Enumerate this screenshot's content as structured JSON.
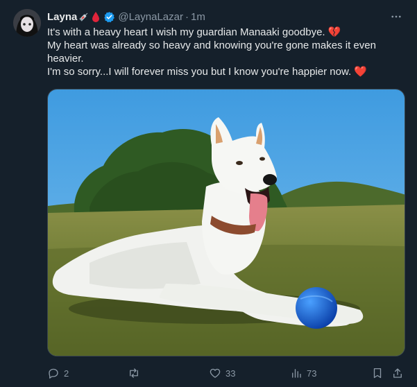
{
  "author": {
    "name": "Layna",
    "handle": "@LaynaLazar",
    "time": "1m",
    "separator": "·"
  },
  "text_lines": [
    "It's with a heavy heart I wish my guardian Manaaki goodbye. 💔",
    "My heart was already so heavy and knowing you're gone makes it even heavier.",
    "I'm so sorry...I will forever miss you but I know you're happier now. ❤️"
  ],
  "actions": {
    "replies": "2",
    "reposts": "",
    "likes": "33",
    "views": "73"
  },
  "icons": {
    "more": "more-icon",
    "verified": "verified-badge-icon",
    "reply": "reply-icon",
    "repost": "repost-icon",
    "like": "like-icon",
    "views": "views-icon",
    "bookmark": "bookmark-icon",
    "share": "share-icon"
  },
  "colors": {
    "background": "#15202b",
    "text": "#e7e9ea",
    "secondary": "#8b98a5",
    "verified": "#1d9bf0",
    "heart": "#f4212e"
  }
}
